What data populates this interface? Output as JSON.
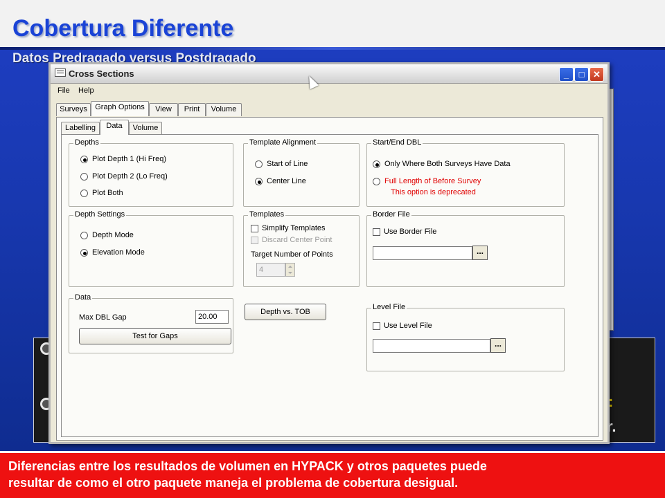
{
  "slide": {
    "title": "Cobertura Diferente",
    "subtitle": "Datos Predragado versus Postdragado",
    "peek_text_1": ":",
    "peek_text_2": "r.",
    "footer_line_1": "Diferencias entre los resultados de volumen en HYPACK y otros paquetes puede",
    "footer_line_2": "resultar de como el otro paquete maneja el problema de cobertura desigual."
  },
  "window": {
    "title": "Cross  Sections",
    "menu": [
      "File",
      "Help"
    ],
    "tabs": [
      "Surveys",
      "Graph Options",
      "View",
      "Print",
      "Volume"
    ],
    "active_tab": "Graph Options",
    "subtabs": [
      "Labelling",
      "Data",
      "Volume"
    ],
    "active_subtab": "Data"
  },
  "depths": {
    "label": "Depths",
    "options": [
      "Plot Depth 1 (Hi Freq)",
      "Plot Depth 2 (Lo Freq)",
      "Plot Both"
    ],
    "selected": "Plot Depth 1 (Hi Freq)"
  },
  "template_alignment": {
    "label": "Template Alignment",
    "options": [
      "Start of Line",
      "Center Line"
    ],
    "selected": "Center Line"
  },
  "start_end_dbl": {
    "label": "Start/End DBL",
    "options": [
      "Only Where Both Surveys Have Data",
      "Full Length of Before Survey"
    ],
    "selected": "Only Where Both Surveys Have Data",
    "deprecated_note": "This option is deprecated"
  },
  "depth_settings": {
    "label": "Depth Settings",
    "options": [
      "Depth Mode",
      "Elevation Mode"
    ],
    "selected": "Elevation Mode"
  },
  "templates": {
    "label": "Templates",
    "simplify": "Simplify Templates",
    "discard": "Discard Center Point",
    "target_label": "Target Number of Points",
    "target_value": "4"
  },
  "border_file": {
    "label": "Border File",
    "checkbox": "Use Border File",
    "browse": "..."
  },
  "data_group": {
    "label": "Data",
    "max_gap_label": "Max DBL Gap",
    "max_gap_value": "20.00",
    "test_button": "Test for Gaps"
  },
  "depth_vs_tob": "Depth vs. TOB",
  "level_file": {
    "label": "Level File",
    "checkbox": "Use Level File",
    "browse": "..."
  },
  "colors": {
    "title_blue": "#1a43d6",
    "footer_red": "#ee1111",
    "deprecated_red": "#e00000"
  }
}
